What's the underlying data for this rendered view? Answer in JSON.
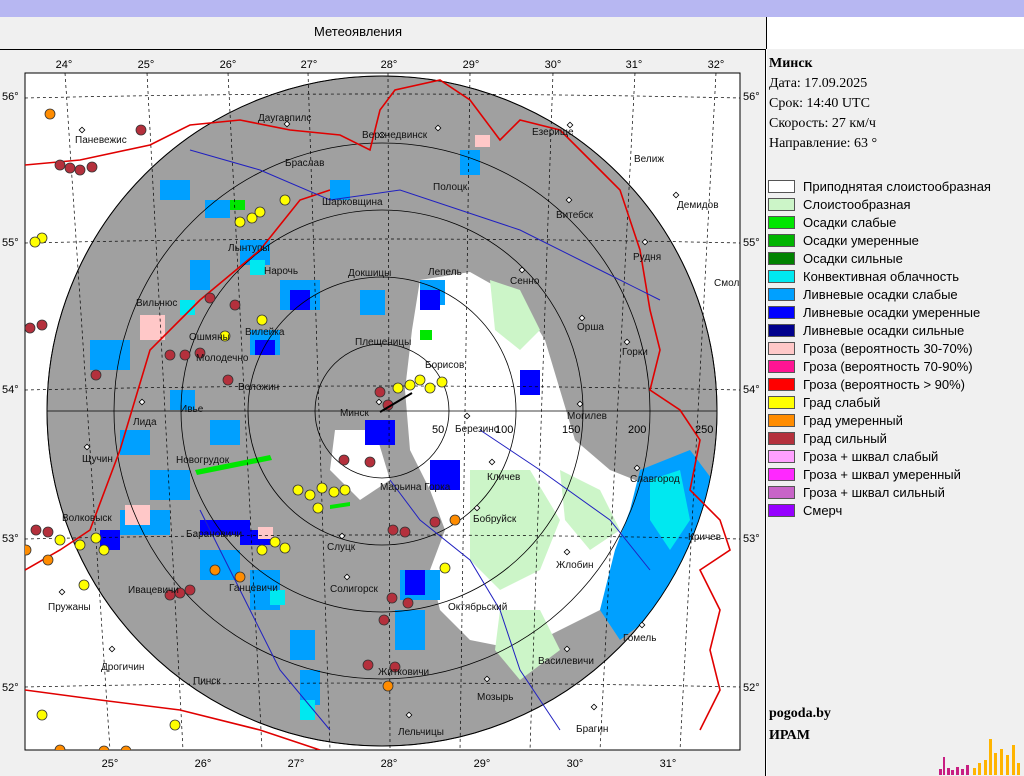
{
  "page": {
    "title": "Метеоявления"
  },
  "info": {
    "station": "Минск",
    "date": "Дата: 17.09.2025",
    "time": "Срок: 14:40 UTC",
    "speed": "Скорость: 27  км/ч",
    "direction": "Направление:  63 °"
  },
  "legend": [
    {
      "label": "Приподнятая слоистообразная",
      "color": "#ffffff"
    },
    {
      "label": "Слоистообразная",
      "color": "#ccf5c8"
    },
    {
      "label": "Осадки слабые",
      "color": "#00e600"
    },
    {
      "label": "Осадки умеренные",
      "color": "#00b400"
    },
    {
      "label": "Осадки сильные",
      "color": "#008200"
    },
    {
      "label": "Конвективная облачность",
      "color": "#00e8f0"
    },
    {
      "label": "Ливневые осадки слабые",
      "color": "#00a0ff"
    },
    {
      "label": "Ливневые осадки умеренные",
      "color": "#0000ff"
    },
    {
      "label": "Ливневые осадки сильные",
      "color": "#00008c"
    },
    {
      "label": "Гроза (вероятность 30-70%)",
      "color": "#ffc8c8"
    },
    {
      "label": "Гроза (вероятность 70-90%)",
      "color": "#ff1493"
    },
    {
      "label": "Гроза (вероятность > 90%)",
      "color": "#ff0000"
    },
    {
      "label": "Град слабый",
      "color": "#ffff00"
    },
    {
      "label": "Град умеренный",
      "color": "#ff8c00"
    },
    {
      "label": "Град сильный",
      "color": "#b4303c"
    },
    {
      "label": "Гроза + шквал слабый",
      "color": "#ffa0ff"
    },
    {
      "label": "Гроза + шквал умеренный",
      "color": "#ff28ff"
    },
    {
      "label": "Гроза + шквал сильный",
      "color": "#c864c8"
    },
    {
      "label": "Смерч",
      "color": "#9600ff"
    }
  ],
  "brand": {
    "site": "pogoda.by",
    "org": "ИРАМ"
  },
  "axes": {
    "lon_top": [
      "24°",
      "25°",
      "26°",
      "27°",
      "28°",
      "29°",
      "30°",
      "31°",
      "32°"
    ],
    "lon_bottom": [
      "25°",
      "26°",
      "27°",
      "28°",
      "29°",
      "30°",
      "31°"
    ],
    "lat_left": [
      "56°",
      "55°",
      "54°",
      "53°",
      "52°"
    ],
    "lat_right": [
      "56°",
      "55°",
      "54°",
      "53°",
      "52°"
    ]
  },
  "range_labels": [
    "50",
    "100",
    "150",
    "200",
    "250"
  ],
  "cities": [
    "Даугавпилс",
    "Верхнедвинск",
    "Езерище",
    "Велиж",
    "Паневежис",
    "Браслав",
    "Полоцк",
    "Шарковщина",
    "Демидов",
    "Витебск",
    "Рудня",
    "Смоленск",
    "Лынтупы",
    "Нарочь",
    "Докшицы",
    "Лепель",
    "Сенно",
    "Вильнюс",
    "Ошмяны",
    "Вилейка",
    "Плещеницы",
    "Борисов",
    "Орша",
    "Горки",
    "Молодечно",
    "Воложин",
    "Минск",
    "Березино",
    "Могилев",
    "Лида",
    "Ивье",
    "Щучин",
    "Новогрудок",
    "Марьина Горка",
    "Кличев",
    "Славгород",
    "Волковыск",
    "Барановичи",
    "Слуцк",
    "Бобруйск",
    "Кричев",
    "Ивацевичи",
    "Ганцевичи",
    "Солигорск",
    "Жлобин",
    "Пружаны",
    "Октябрьский",
    "Гомель",
    "Дрогичин",
    "Пинск",
    "Житковичи",
    "Василевичи",
    "Мозырь",
    "Лельчицы",
    "Брагин"
  ]
}
